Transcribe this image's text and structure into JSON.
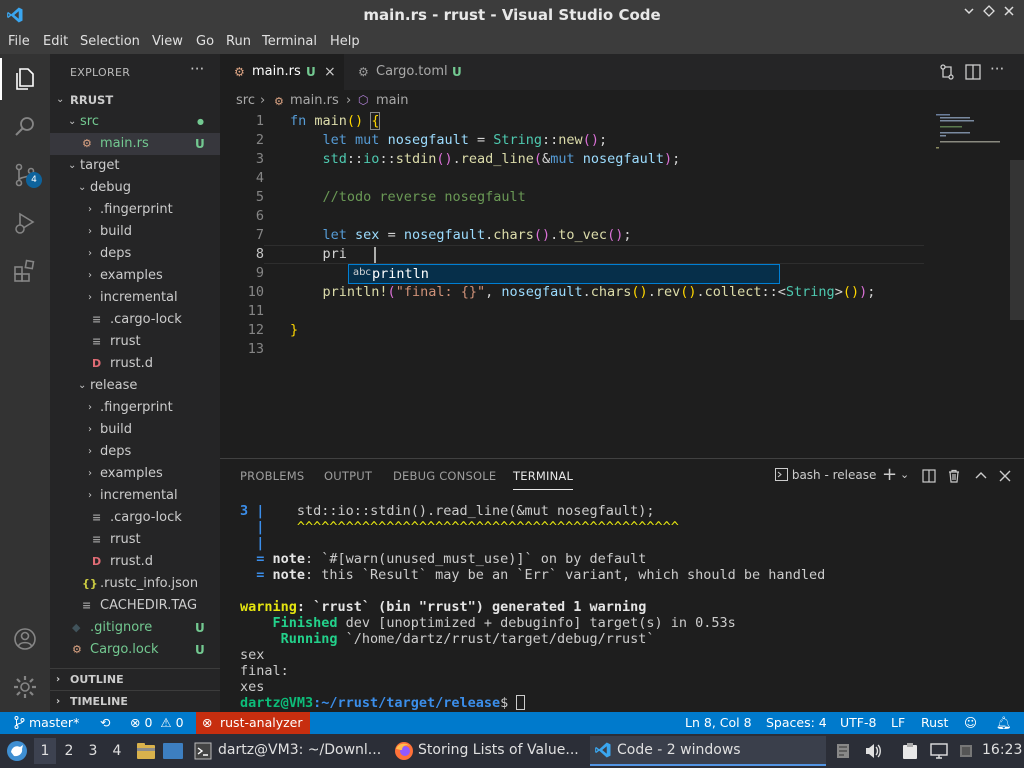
{
  "window": {
    "title": "main.rs - rrust - Visual Studio Code"
  },
  "menu": [
    "File",
    "Edit",
    "Selection",
    "View",
    "Go",
    "Run",
    "Terminal",
    "Help"
  ],
  "activity": {
    "scm_badge": "4"
  },
  "explorer": {
    "header": "EXPLORER",
    "root": "RRUST",
    "items": [
      {
        "label": "src",
        "chev": "⌄",
        "status": "●",
        "depth": 1
      },
      {
        "label": "main.rs",
        "status": "U",
        "depth": 2,
        "icon": "rust"
      },
      {
        "label": "target",
        "chev": "⌄",
        "depth": 1
      },
      {
        "label": "debug",
        "chev": "⌄",
        "depth": 2
      },
      {
        "label": ".fingerprint",
        "chev": "›",
        "depth": 3
      },
      {
        "label": "build",
        "chev": "›",
        "depth": 3
      },
      {
        "label": "deps",
        "chev": "›",
        "depth": 3
      },
      {
        "label": "examples",
        "chev": "›",
        "depth": 3
      },
      {
        "label": "incremental",
        "chev": "›",
        "depth": 3
      },
      {
        "label": ".cargo-lock",
        "depth": 3,
        "icon": "lines"
      },
      {
        "label": "rrust",
        "depth": 3,
        "icon": "lines"
      },
      {
        "label": "rrust.d",
        "depth": 3,
        "icon": "D"
      },
      {
        "label": "release",
        "chev": "⌄",
        "depth": 2
      },
      {
        "label": ".fingerprint",
        "chev": "›",
        "depth": 3
      },
      {
        "label": "build",
        "chev": "›",
        "depth": 3
      },
      {
        "label": "deps",
        "chev": "›",
        "depth": 3
      },
      {
        "label": "examples",
        "chev": "›",
        "depth": 3
      },
      {
        "label": "incremental",
        "chev": "›",
        "depth": 3
      },
      {
        "label": ".cargo-lock",
        "depth": 3,
        "icon": "lines"
      },
      {
        "label": "rrust",
        "depth": 3,
        "icon": "lines"
      },
      {
        "label": "rrust.d",
        "depth": 3,
        "icon": "D"
      },
      {
        "label": ".rustc_info.json",
        "depth": 2,
        "icon": "json"
      },
      {
        "label": "CACHEDIR.TAG",
        "depth": 2,
        "icon": "lines"
      },
      {
        "label": ".gitignore",
        "status": "U",
        "depth": 1,
        "icon": "git"
      },
      {
        "label": "Cargo.lock",
        "status": "U",
        "depth": 1,
        "icon": "rust"
      }
    ],
    "outline": "OUTLINE",
    "timeline": "TIMELINE"
  },
  "tabs": [
    {
      "label": "main.rs",
      "status": "U",
      "close": "×"
    },
    {
      "label": "Cargo.toml",
      "status": "U"
    }
  ],
  "breadcrumb": {
    "folder": "src",
    "file": "main.rs",
    "symbol": "main"
  },
  "editor": {
    "line_numbers": [
      "1",
      "2",
      "3",
      "4",
      "5",
      "6",
      "7",
      "8",
      "9",
      "10",
      "11",
      "12",
      "13"
    ],
    "typed": "pri",
    "suggestion": {
      "kind": "abc",
      "label": "println"
    }
  },
  "panel": {
    "tabs": [
      "PROBLEMS",
      "OUTPUT",
      "DEBUG CONSOLE",
      "TERMINAL"
    ],
    "terminal_name": "bash - release",
    "lines": {
      "l1_num": "3",
      "l1_code": "    std::io::stdin().read_line(&mut nosegfault);",
      "l1_squig": "    ^^^^^^^^^^^^^^^^^^^^^^^^^^^^^^^^^^^^^^^^^^^^^^^",
      "note1_key": "note",
      "note1_text": ": `#[warn(unused_must_use)]` on by default",
      "note2_key": "note",
      "note2_text": ": this `Result` may be an `Err` variant, which should be handled",
      "warn_key": "warning",
      "warn_text": ": `rrust` (bin \"rrust\") generated 1 warning",
      "finished_key": "Finished",
      "finished_text": " dev [unoptimized + debuginfo] target(s) in 0.53s",
      "running_key": "Running",
      "running_text": " `/home/dartz/rrust/target/debug/rrust`",
      "out1": "sex",
      "out2": "final:",
      "out3": "xes",
      "prompt_user": "dartz@VM3",
      "prompt_path": ":~/rrust/target/release",
      "prompt_sign": "$ "
    }
  },
  "status": {
    "branch": "master*",
    "errors": "0",
    "warnings": "0",
    "analyzer": "rust-analyzer",
    "position": "Ln 8, Col 8",
    "spaces": "Spaces: 4",
    "encoding": "UTF-8",
    "eol": "LF",
    "language": "Rust"
  },
  "taskbar": {
    "workspaces": [
      "1",
      "2",
      "3",
      "4"
    ],
    "win_terminal": "dartz@VM3: ~/Downl...",
    "win_firefox": "Storing Lists of Value...",
    "win_code": "Code - 2 windows",
    "clock": "16:23"
  },
  "colors": {
    "accent": "#007acc",
    "analyzer_error": "#c72e0f",
    "untracked": "#73c991"
  }
}
